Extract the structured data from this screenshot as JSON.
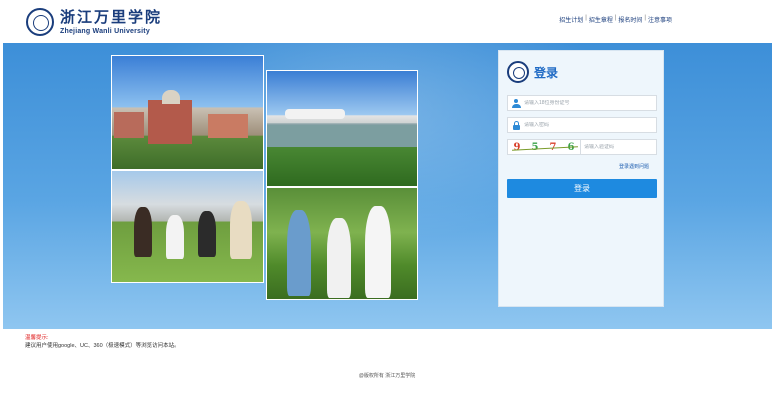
{
  "header": {
    "logo_cn": "浙江万里学院",
    "logo_en": "Zhejiang Wanli University",
    "links": [
      "招生计划",
      "招生章程",
      "报名时间",
      "注意事项"
    ]
  },
  "login": {
    "title": "登录",
    "id_placeholder": "请输入18位身份证号",
    "password_placeholder": "请输入密码",
    "captcha_chars": [
      "9",
      "5",
      "7",
      "6"
    ],
    "captcha_placeholder": "请输入验证码",
    "help_link": "登录遇到问题",
    "submit_label": "登录"
  },
  "tips": {
    "title": "温馨提示:",
    "body": "建议用户使用google、UC、360（极速模式）等浏览访问本站。"
  },
  "footer": {
    "copyright": "@版权所有 浙江万里学院"
  },
  "colors": {
    "brand_blue": "#1a3d7c",
    "button_blue": "#1e8ae0",
    "banner_blue": "#3d8fd8",
    "tip_red": "#e02020"
  },
  "icons": [
    "university-seal-icon",
    "user-icon",
    "lock-icon"
  ]
}
